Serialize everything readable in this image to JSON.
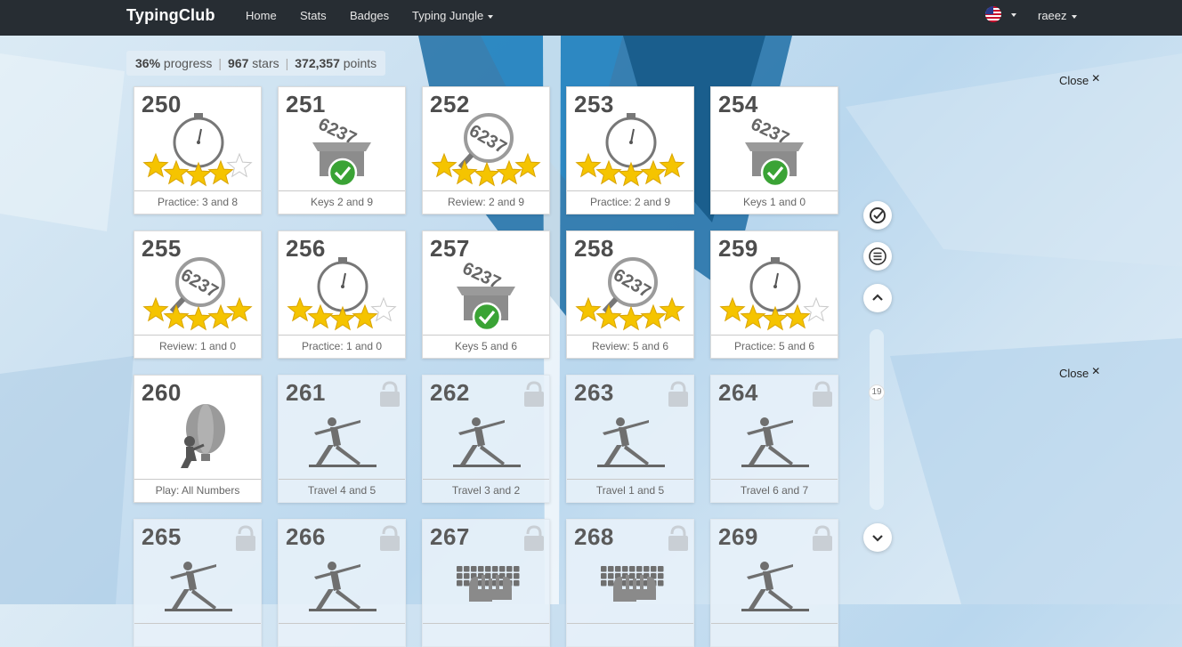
{
  "nav": {
    "brand": "TypingClub",
    "links": [
      "Home",
      "Stats",
      "Badges",
      "Typing Jungle"
    ],
    "user": "raeez"
  },
  "stats": {
    "progress_value": "36%",
    "progress_label": "progress",
    "stars_value": "967",
    "stars_label": "stars",
    "points_value": "372,357",
    "points_label": "points"
  },
  "lessons": [
    {
      "num": "250",
      "label": "Practice: 3 and 8",
      "type": "timer",
      "stars": 4,
      "locked": false
    },
    {
      "num": "251",
      "label": "Keys 2 and 9",
      "type": "box",
      "stars": 0,
      "locked": false
    },
    {
      "num": "252",
      "label": "Review: 2 and 9",
      "type": "magnifier",
      "stars": 5,
      "locked": false
    },
    {
      "num": "253",
      "label": "Practice: 2 and 9",
      "type": "timer",
      "stars": 5,
      "locked": false
    },
    {
      "num": "254",
      "label": "Keys 1 and 0",
      "type": "box",
      "stars": 0,
      "locked": false
    },
    {
      "num": "255",
      "label": "Review: 1 and 0",
      "type": "magnifier",
      "stars": 5,
      "locked": false
    },
    {
      "num": "256",
      "label": "Practice: 1 and 0",
      "type": "timer",
      "stars": 4,
      "locked": false
    },
    {
      "num": "257",
      "label": "Keys 5 and 6",
      "type": "box",
      "stars": 0,
      "locked": false
    },
    {
      "num": "258",
      "label": "Review: 5 and 6",
      "type": "magnifier",
      "stars": 5,
      "locked": false
    },
    {
      "num": "259",
      "label": "Practice: 5 and 6",
      "type": "timer",
      "stars": 4,
      "locked": false
    },
    {
      "num": "260",
      "label": "Play: All Numbers",
      "type": "balloon",
      "stars": 0,
      "locked": false
    },
    {
      "num": "261",
      "label": "Travel 4 and 5",
      "type": "yoga",
      "stars": 0,
      "locked": true
    },
    {
      "num": "262",
      "label": "Travel 3 and 2",
      "type": "yoga",
      "stars": 0,
      "locked": true
    },
    {
      "num": "263",
      "label": "Travel 1 and 5",
      "type": "yoga",
      "stars": 0,
      "locked": true
    },
    {
      "num": "264",
      "label": "Travel 6 and 7",
      "type": "yoga",
      "stars": 0,
      "locked": true
    },
    {
      "num": "265",
      "label": "",
      "type": "yoga",
      "stars": 0,
      "locked": true
    },
    {
      "num": "266",
      "label": "",
      "type": "yoga",
      "stars": 0,
      "locked": true
    },
    {
      "num": "267",
      "label": "",
      "type": "keyboard",
      "stars": 0,
      "locked": true
    },
    {
      "num": "268",
      "label": "",
      "type": "keyboard",
      "stars": 0,
      "locked": true
    },
    {
      "num": "269",
      "label": "",
      "type": "yoga",
      "stars": 0,
      "locked": true
    }
  ],
  "sidebar": {
    "scroll_value": "19",
    "icons": [
      "check-circle-icon",
      "menu-icon",
      "chevron-up-icon",
      "chevron-down-icon"
    ]
  },
  "close_labels": [
    "Close",
    "Close"
  ],
  "colors": {
    "star": "#f5c400",
    "check": "#3aa335",
    "navbar": "#272d33",
    "icon_gray": "#777777"
  }
}
